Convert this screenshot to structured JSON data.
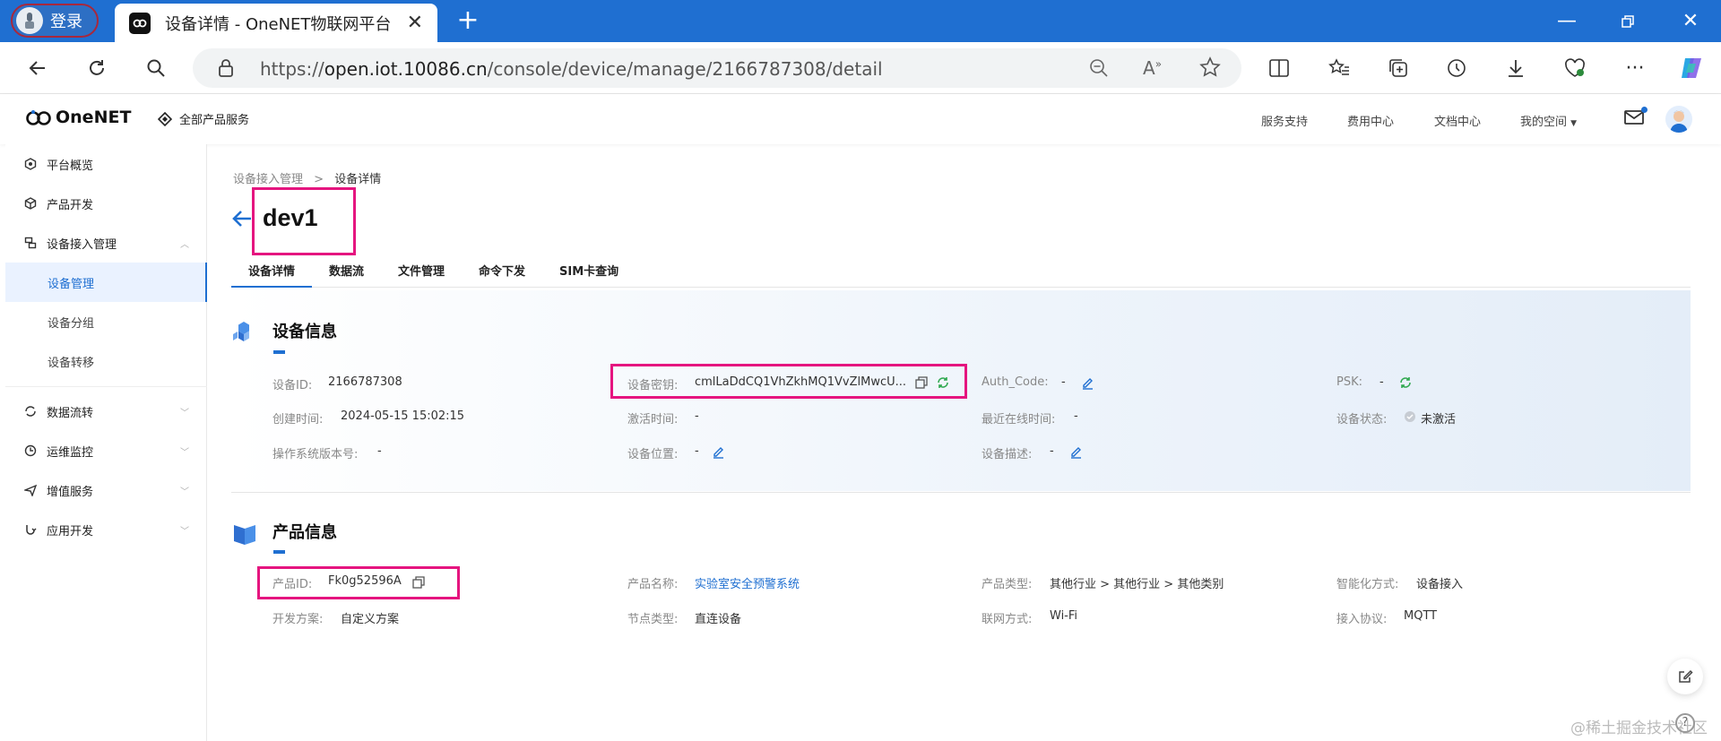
{
  "browser": {
    "login_label": "登录",
    "tab_title": "设备详情 - OneNET物联网平台",
    "url_prefix": "https://",
    "url_host": "open.iot.10086.cn",
    "url_path": "/console/device/manage/2166787308/detail",
    "accent": "#1f6fd1"
  },
  "app": {
    "logo_text": "OneNET",
    "all_products": "全部产品服务",
    "nav": {
      "support": "服务支持",
      "billing": "费用中心",
      "docs": "文档中心",
      "space": "我的空间"
    }
  },
  "sidebar": {
    "items": [
      {
        "label": "平台概览",
        "icon": "dashboard-icon"
      },
      {
        "label": "产品开发",
        "icon": "cube-icon"
      },
      {
        "label": "设备接入管理",
        "icon": "device-icon"
      },
      {
        "label": "数据流转",
        "icon": "flow-icon"
      },
      {
        "label": "运维监控",
        "icon": "monitor-icon"
      },
      {
        "label": "增值服务",
        "icon": "send-icon"
      },
      {
        "label": "应用开发",
        "icon": "app-icon"
      }
    ],
    "sub": [
      {
        "label": "设备管理",
        "active": true
      },
      {
        "label": "设备分组"
      },
      {
        "label": "设备转移"
      }
    ]
  },
  "page": {
    "breadcrumb": {
      "parent": "设备接入管理",
      "sep": ">",
      "current": "设备详情"
    },
    "device_name": "dev1",
    "tabs": [
      "设备详情",
      "数据流",
      "文件管理",
      "命令下发",
      "SIM卡查询"
    ]
  },
  "device_info": {
    "title": "设备信息",
    "fields": {
      "device_id": {
        "label": "设备ID:",
        "value": "2166787308"
      },
      "device_key": {
        "label": "设备密钥:",
        "value": "cmlLaDdCQ1VhZkhMQ1VvZlMwcU..."
      },
      "auth_code": {
        "label": "Auth_Code:",
        "value": "-"
      },
      "psk": {
        "label": "PSK:",
        "value": "-"
      },
      "created": {
        "label": "创建时间:",
        "value": "2024-05-15 15:02:15"
      },
      "activated": {
        "label": "激活时间:",
        "value": "-"
      },
      "last_online": {
        "label": "最近在线时间:",
        "value": "-"
      },
      "status": {
        "label": "设备状态:",
        "value": "未激活"
      },
      "os_version": {
        "label": "操作系统版本号:",
        "value": "-"
      },
      "location": {
        "label": "设备位置:",
        "value": "-"
      },
      "description": {
        "label": "设备描述:",
        "value": "-"
      }
    }
  },
  "product_info": {
    "title": "产品信息",
    "fields": {
      "product_id": {
        "label": "产品ID:",
        "value": "Fk0g52596A"
      },
      "product_name": {
        "label": "产品名称:",
        "value": "实验室安全预警系统"
      },
      "product_type": {
        "label": "产品类型:",
        "value": "其他行业 > 其他行业 > 其他类别"
      },
      "smart_mode": {
        "label": "智能化方式:",
        "value": "设备接入"
      },
      "dev_plan": {
        "label": "开发方案:",
        "value": "自定义方案"
      },
      "node_type": {
        "label": "节点类型:",
        "value": "直连设备"
      },
      "network": {
        "label": "联网方式:",
        "value": "Wi-Fi"
      },
      "protocol": {
        "label": "接入协议:",
        "value": "MQTT"
      }
    }
  },
  "watermark": "@稀土掘金技术社区"
}
